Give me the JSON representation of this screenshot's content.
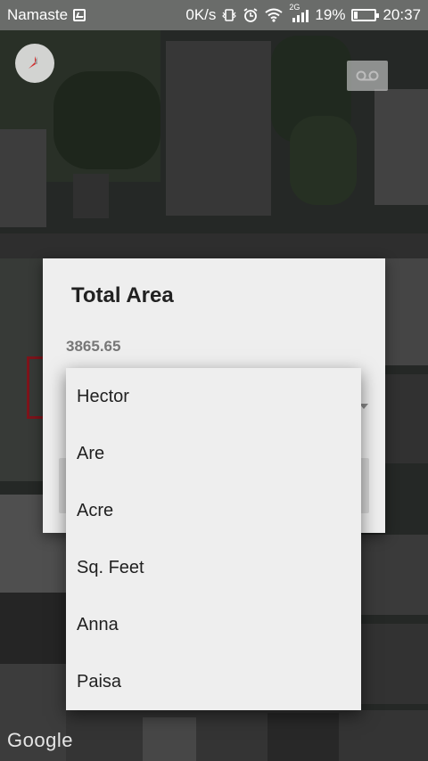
{
  "status_bar": {
    "carrier": "Namaste",
    "speed": "0K/s",
    "network": "2G",
    "battery": "19%",
    "time": "20:37"
  },
  "map": {
    "attribution": "Google"
  },
  "dialog": {
    "title": "Total Area",
    "value": "3865.65"
  },
  "dropdown": {
    "items": [
      "Hector",
      "Are",
      "Acre",
      "Sq. Feet",
      "Anna",
      "Paisa"
    ]
  }
}
